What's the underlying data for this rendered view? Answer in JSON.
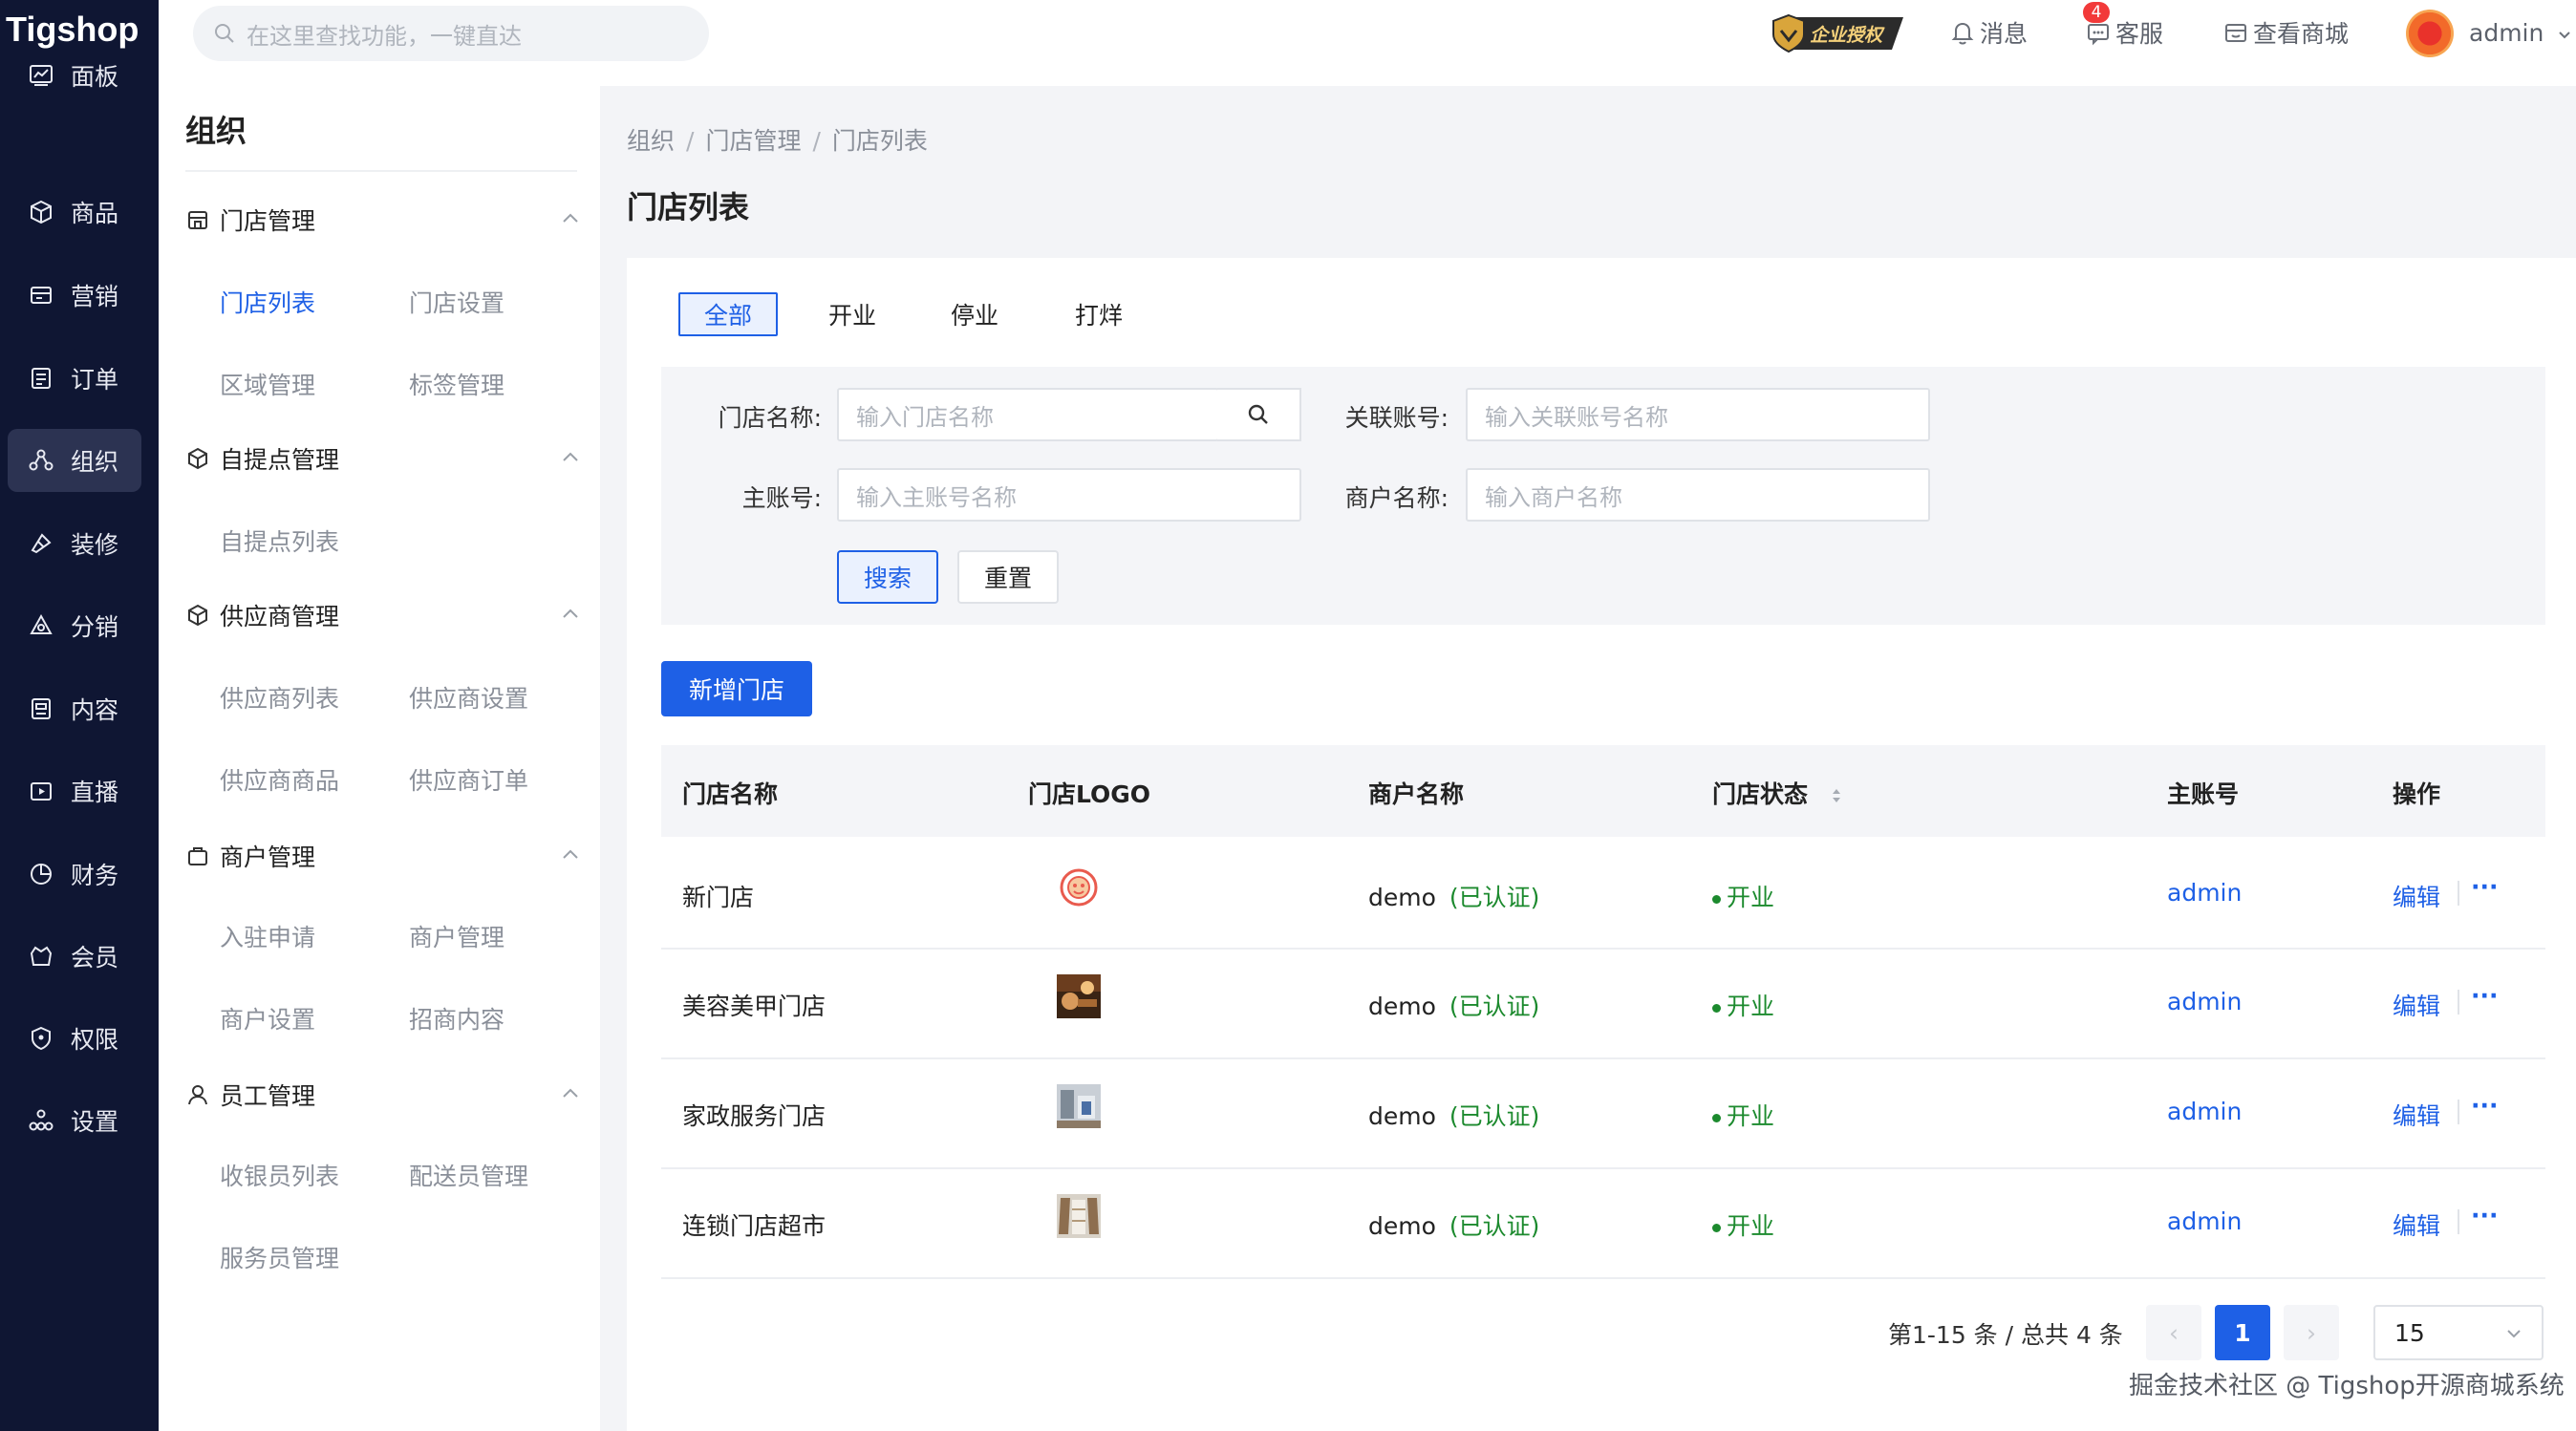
{
  "app": {
    "logo_text": "Tigshop"
  },
  "colors": {
    "primary": "#1e60e6",
    "nav_bg": "#0f1633",
    "success": "#1c8a2e",
    "badge": "#f23a3a"
  },
  "left_nav": [
    {
      "label": "面板",
      "icon": "dashboard-icon"
    },
    {
      "label": "商品",
      "icon": "box-icon"
    },
    {
      "label": "营销",
      "icon": "marketing-icon"
    },
    {
      "label": "订单",
      "icon": "order-icon"
    },
    {
      "label": "组织",
      "icon": "organization-icon",
      "active": true
    },
    {
      "label": "装修",
      "icon": "decoration-icon"
    },
    {
      "label": "分销",
      "icon": "distribution-icon"
    },
    {
      "label": "内容",
      "icon": "content-icon"
    },
    {
      "label": "直播",
      "icon": "live-icon"
    },
    {
      "label": "财务",
      "icon": "finance-icon"
    },
    {
      "label": "会员",
      "icon": "member-icon"
    },
    {
      "label": "权限",
      "icon": "permission-icon"
    },
    {
      "label": "设置",
      "icon": "settings-icon"
    }
  ],
  "topbar": {
    "search_placeholder": "在这里查找功能，一键直达",
    "enterprise_label": "企业授权",
    "messages": "消息",
    "service": "客服",
    "service_badge": "4",
    "view_store": "查看商城",
    "user": "admin"
  },
  "sub_nav": {
    "title": "组织",
    "groups": [
      {
        "label": "门店管理",
        "icon": "store-icon",
        "items": [
          "门店列表",
          "门店设置",
          "区域管理",
          "标签管理"
        ]
      },
      {
        "label": "自提点管理",
        "icon": "pickup-icon",
        "items": [
          "自提点列表"
        ]
      },
      {
        "label": "供应商管理",
        "icon": "supplier-icon",
        "items": [
          "供应商列表",
          "供应商设置",
          "供应商商品",
          "供应商订单"
        ]
      },
      {
        "label": "商户管理",
        "icon": "merchant-icon",
        "items": [
          "入驻申请",
          "商户管理",
          "商户设置",
          "招商内容"
        ]
      },
      {
        "label": "员工管理",
        "icon": "staff-icon",
        "items": [
          "收银员列表",
          "配送员管理",
          "服务员管理"
        ]
      }
    ]
  },
  "breadcrumb": [
    "组织",
    "门店管理",
    "门店列表"
  ],
  "breadcrumb_sep": "/",
  "page_title": "门店列表",
  "tabs": [
    "全部",
    "开业",
    "停业",
    "打烊"
  ],
  "filters": {
    "store_name": {
      "label": "门店名称:",
      "placeholder": "输入门店名称"
    },
    "linked_account": {
      "label": "关联账号:",
      "placeholder": "输入关联账号名称"
    },
    "main_account": {
      "label": "主账号:",
      "placeholder": "输入主账号名称"
    },
    "merchant_name": {
      "label": "商户名称:",
      "placeholder": "输入商户名称"
    },
    "search_label": "搜索",
    "reset_label": "重置"
  },
  "add_button": "新增门店",
  "table": {
    "headers": [
      "门店名称",
      "门店LOGO",
      "商户名称",
      "门店状态",
      "主账号",
      "操作"
    ],
    "rows": [
      {
        "name": "新门店",
        "merchant": "demo",
        "cert": "(已认证)",
        "status": "开业",
        "account": "admin",
        "action": "编辑",
        "more": "···"
      },
      {
        "name": "美容美甲门店",
        "merchant": "demo",
        "cert": "(已认证)",
        "status": "开业",
        "account": "admin",
        "action": "编辑",
        "more": "···"
      },
      {
        "name": "家政服务门店",
        "merchant": "demo",
        "cert": "(已认证)",
        "status": "开业",
        "account": "admin",
        "action": "编辑",
        "more": "···"
      },
      {
        "name": "连锁门店超市",
        "merchant": "demo",
        "cert": "(已认证)",
        "status": "开业",
        "account": "admin",
        "action": "编辑",
        "more": "···"
      }
    ]
  },
  "pagination": {
    "summary": "第1-15 条 / 总共 4 条",
    "current": "1",
    "page_size": "15",
    "prev": "‹",
    "next": "›"
  },
  "watermark": "掘金技术社区 @ Tigshop开源商城系统"
}
